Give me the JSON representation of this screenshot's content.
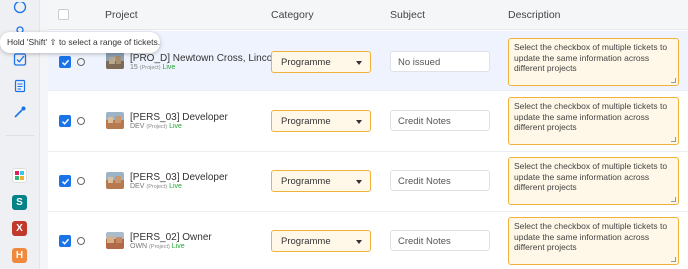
{
  "tooltip": "Hold 'Shift' ⇧ to select a range of tickets.",
  "headers": {
    "project": "Project",
    "category": "Category",
    "subject": "Subject",
    "description": "Description"
  },
  "rows": [
    {
      "name": "[PRO_D] Newtown Cross, Lincoln",
      "code": "15",
      "type": "(Project)",
      "status": "Live",
      "category": "Programme",
      "subject": "No issued",
      "description": "Select the checkbox of multiple tickets to update the same information across different projects"
    },
    {
      "name": "[PERS_03] Developer",
      "code": "DEV",
      "type": "(Project)",
      "status": "Live",
      "category": "Programme",
      "subject": "Credit Notes",
      "description": "Select the checkbox of multiple tickets to update the same information across different projects"
    },
    {
      "name": "[PERS_03] Developer",
      "code": "DEV",
      "type": "(Project)",
      "status": "Live",
      "category": "Programme",
      "subject": "Credit Notes",
      "description": "Select the checkbox of multiple tickets to update the same information across different projects"
    },
    {
      "name": "[PERS_02] Owner",
      "code": "OWN",
      "type": "(Project)",
      "status": "Live",
      "category": "Programme",
      "subject": "Credit Notes",
      "description": "Select the checkbox of multiple tickets to update the same information across different projects"
    }
  ],
  "sidebar_apps": [
    {
      "icon": "slack-icon",
      "letter": "",
      "color": "#2eb67d"
    },
    {
      "icon": "sharepoint-icon",
      "letter": "S",
      "color": "#038387"
    },
    {
      "icon": "excel-icon",
      "letter": "X",
      "color": "#c0392b"
    },
    {
      "icon": "hubspot-icon",
      "letter": "H",
      "color": "#f0883e"
    }
  ],
  "colors": {
    "accent": "#1a73e8",
    "select_border": "#f0b23a",
    "live": "#22a833"
  }
}
